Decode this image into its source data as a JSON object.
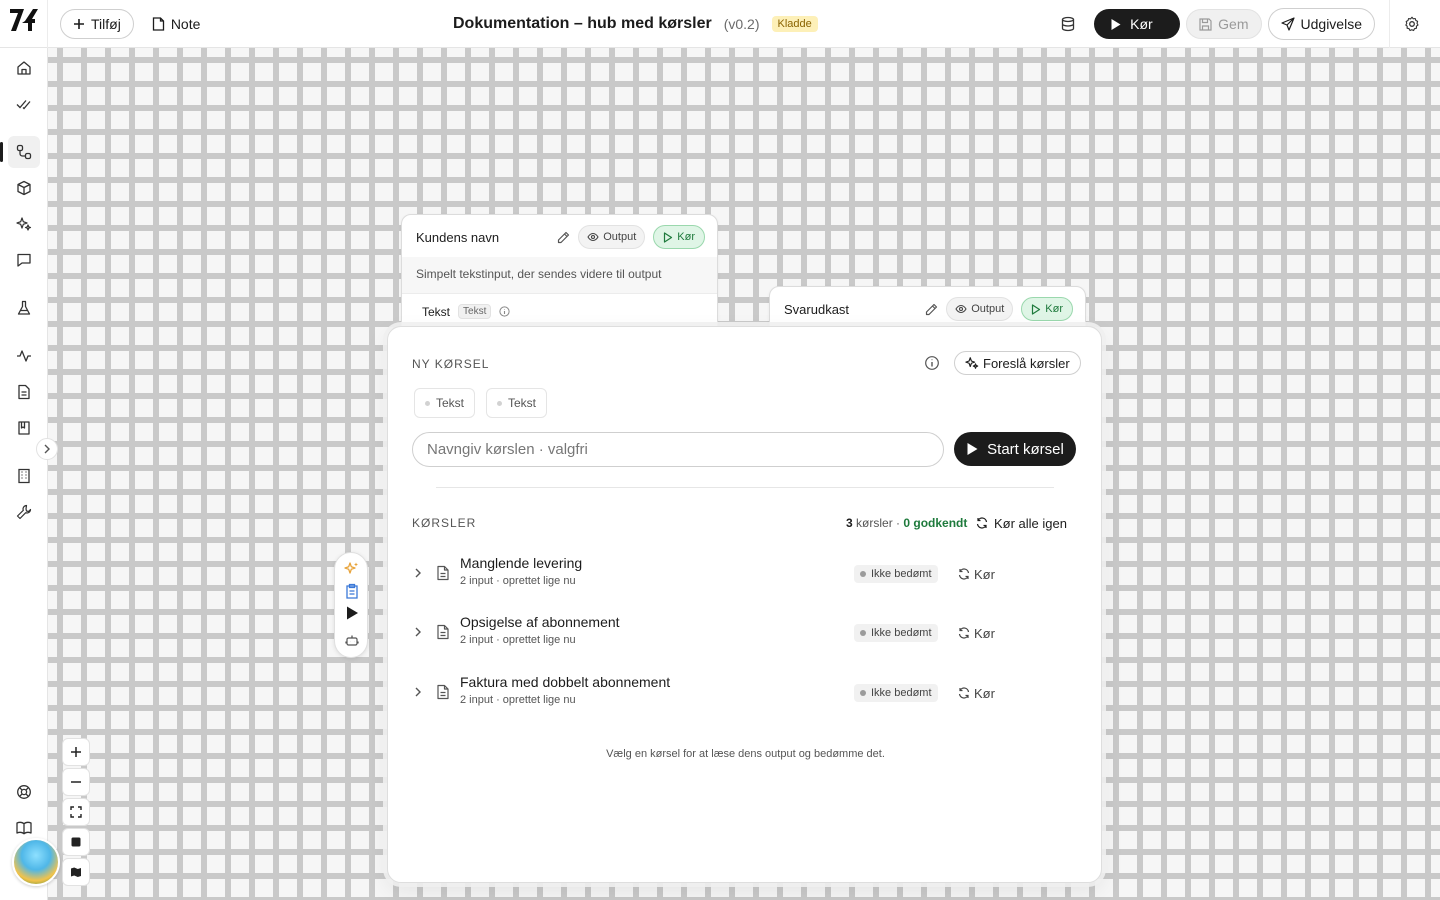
{
  "header": {
    "add_label": "Tilføj",
    "note_label": "Note",
    "title": "Dokumentation – hub med kørsler",
    "version": "(v0.2)",
    "draft_badge": "Kladde",
    "run_label": "Kør",
    "save_label": "Gem",
    "publish_label": "Udgivelse"
  },
  "nodes": [
    {
      "title": "Kundens navn",
      "output_label": "Output",
      "run_label": "Kør",
      "description": "Simpelt tekstinput, der sendes videre til output",
      "field_label": "Tekst",
      "field_type": "Tekst"
    },
    {
      "title": "Svarudkast",
      "output_label": "Output",
      "run_label": "Kør"
    }
  ],
  "panel": {
    "new_run_label": "NY KØRSEL",
    "suggest_label": "Foreslå kørsler",
    "input_chips": [
      "Tekst",
      "Tekst"
    ],
    "name_placeholder": "Navngiv kørslen · valgfri",
    "start_label": "Start kørsel",
    "runs_label": "KØRSLER",
    "runs_count": "3",
    "runs_word": "kørsler ·",
    "approved": "0 godkendt",
    "rerun_all_label": "Kør alle igen",
    "runs": [
      {
        "title": "Manglende levering",
        "meta": "2 input · oprettet lige nu",
        "status": "Ikke bedømt",
        "run_label": "Kør"
      },
      {
        "title": "Opsigelse af abonnement",
        "meta": "2 input · oprettet lige nu",
        "status": "Ikke bedømt",
        "run_label": "Kør"
      },
      {
        "title": "Faktura med dobbelt abonnement",
        "meta": "2 input · oprettet lige nu",
        "status": "Ikke bedømt",
        "run_label": "Kør"
      }
    ],
    "hint": "Vælg en kørsel for at læse dens output og bedømme det."
  },
  "colors": {
    "accent_dark": "#1c1c1c",
    "run_green": "#1e7a3c",
    "draft_yellow": "#fdf0b8"
  },
  "icons": {
    "sidebar": [
      "home-icon",
      "check-double-icon",
      "workflow-icon",
      "cube-icon",
      "sparkle-icon",
      "chat-icon",
      "flask-icon",
      "activity-icon",
      "document-icon",
      "book-icon",
      "building-icon",
      "wrench-icon",
      "lifebuoy-icon",
      "open-book-icon"
    ]
  }
}
